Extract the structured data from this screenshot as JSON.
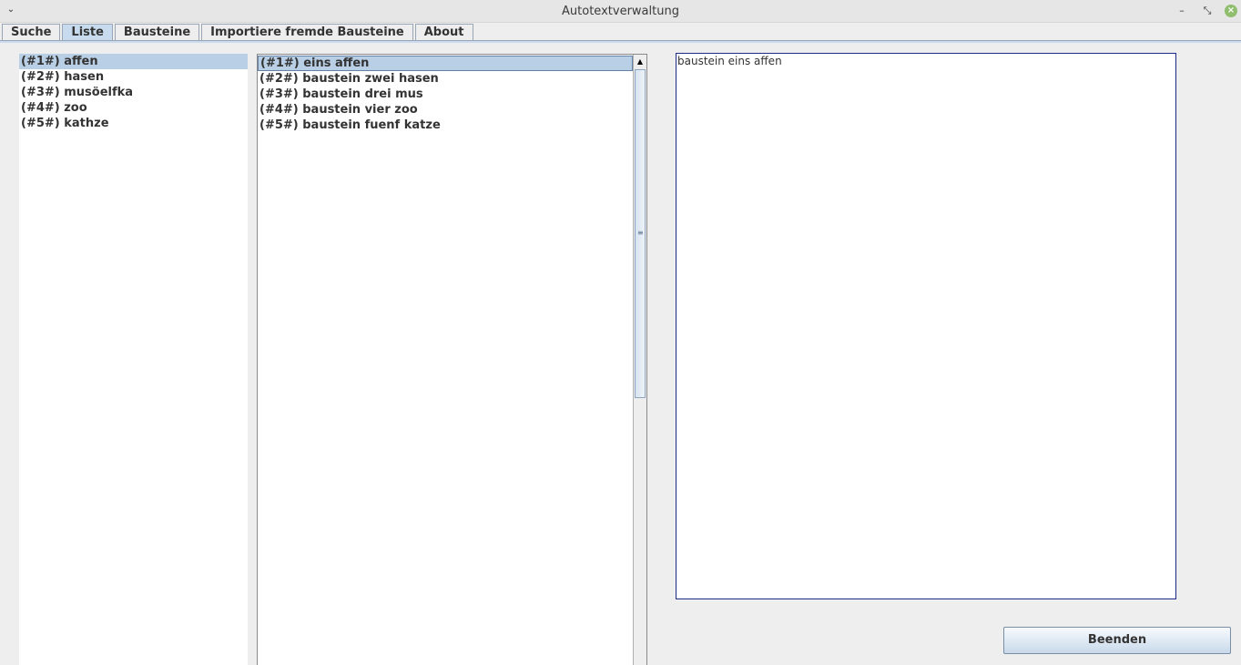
{
  "window": {
    "title": "Autotextverwaltung",
    "menu_glyph": "⌄",
    "minimize_glyph": "–",
    "maximize_glyph": "⤡",
    "close_glyph": "×"
  },
  "tabs": [
    {
      "label": "Suche",
      "active": false
    },
    {
      "label": "Liste",
      "active": true
    },
    {
      "label": "Bausteine",
      "active": false
    },
    {
      "label": "Importiere fremde Bausteine",
      "active": false
    },
    {
      "label": "About",
      "active": false
    }
  ],
  "left_list": {
    "items": [
      {
        "label": "(#1#) affen",
        "selected": true
      },
      {
        "label": "(#2#) hasen",
        "selected": false
      },
      {
        "label": "(#3#) musöelfka",
        "selected": false
      },
      {
        "label": "(#4#) zoo",
        "selected": false
      },
      {
        "label": "(#5#) kathze",
        "selected": false
      }
    ]
  },
  "middle_list": {
    "items": [
      {
        "label": "(#1#) eins affen",
        "selected": true
      },
      {
        "label": "(#2#) baustein zwei hasen",
        "selected": false
      },
      {
        "label": "(#3#) baustein drei mus",
        "selected": false
      },
      {
        "label": "(#4#) baustein vier zoo",
        "selected": false
      },
      {
        "label": "(#5#) baustein fuenf katze",
        "selected": false
      }
    ],
    "scroll_up_glyph": "▲",
    "thumb_grip_glyph": "≡"
  },
  "text_area": {
    "content": "baustein eins affen"
  },
  "buttons": {
    "beenden": "Beenden"
  },
  "colors": {
    "selection": "#b8cfe5",
    "active_tab": "#c8dbee",
    "textarea_border": "#1c2a8a"
  }
}
